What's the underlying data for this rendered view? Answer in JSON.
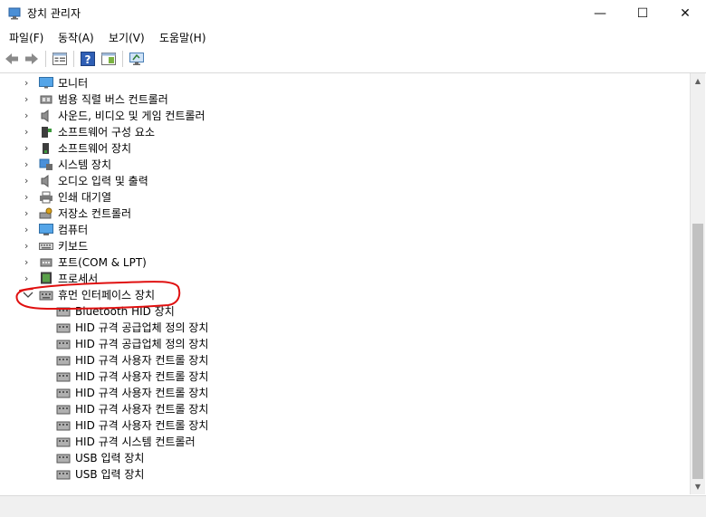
{
  "window": {
    "title": "장치 관리자",
    "controls": {
      "minimize": "—",
      "maximize": "☐",
      "close": "✕"
    }
  },
  "menu": [
    "파일(F)",
    "동작(A)",
    "보기(V)",
    "도움말(H)"
  ],
  "toolbar": {
    "icons": [
      "back-arrow-icon",
      "forward-arrow-icon",
      "properties-icon",
      "help-icon",
      "details-pane-icon",
      "monitor-scan-icon"
    ]
  },
  "tree": {
    "categories": [
      {
        "label": "모니터",
        "icon": "monitor-icon",
        "expanded": false
      },
      {
        "label": "범용 직렬 버스 컨트롤러",
        "icon": "usb-controller-icon",
        "expanded": false
      },
      {
        "label": "사운드, 비디오 및 게임 컨트롤러",
        "icon": "speaker-icon",
        "expanded": false
      },
      {
        "label": "소프트웨어 구성 요소",
        "icon": "software-component-icon",
        "expanded": false
      },
      {
        "label": "소프트웨어 장치",
        "icon": "software-device-icon",
        "expanded": false
      },
      {
        "label": "시스템 장치",
        "icon": "system-device-icon",
        "expanded": false
      },
      {
        "label": "오디오 입력 및 출력",
        "icon": "audio-icon",
        "expanded": false
      },
      {
        "label": "인쇄 대기열",
        "icon": "printer-icon",
        "expanded": false
      },
      {
        "label": "저장소 컨트롤러",
        "icon": "storage-controller-icon",
        "expanded": false
      },
      {
        "label": "컴퓨터",
        "icon": "computer-icon",
        "expanded": false
      },
      {
        "label": "키보드",
        "icon": "keyboard-icon",
        "expanded": false
      },
      {
        "label": "포트(COM & LPT)",
        "icon": "port-icon",
        "expanded": false
      },
      {
        "label": "프로세서",
        "icon": "processor-icon",
        "expanded": false
      },
      {
        "label": "휴먼 인터페이스 장치",
        "icon": "hid-icon",
        "expanded": true
      }
    ],
    "hid_children": [
      "Bluetooth HID 장치",
      "HID 규격 공급업체 정의 장치",
      "HID 규격 공급업체 정의 장치",
      "HID 규격 사용자 컨트롤 장치",
      "HID 규격 사용자 컨트롤 장치",
      "HID 규격 사용자 컨트롤 장치",
      "HID 규격 사용자 컨트롤 장치",
      "HID 규격 사용자 컨트롤 장치",
      "HID 규격 시스템 컨트롤러",
      "USB 입력 장치",
      "USB 입력 장치"
    ]
  },
  "scrollbar": {
    "position": 0.76
  },
  "colors": {
    "annotation": "#e01010",
    "accent": "#0078d7",
    "tree_line": "#444444"
  }
}
